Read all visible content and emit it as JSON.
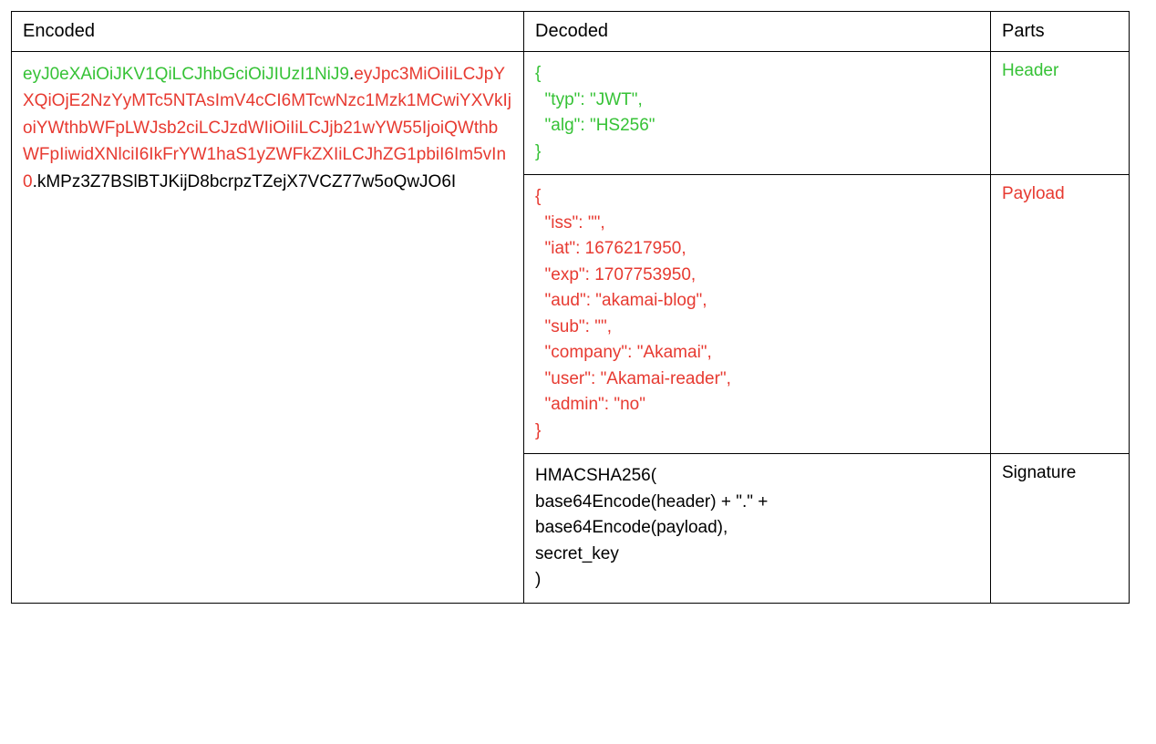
{
  "headers": {
    "encoded": "Encoded",
    "decoded": "Decoded",
    "parts": "Parts"
  },
  "encoded": {
    "header_part": "eyJ0eXAiOiJKV1QiLCJhbGciOiJIUzI1NiJ9",
    "dot1": ".",
    "payload_part": "eyJpc3MiOiIiLCJpYXQiOjE2NzYyMTc5NTAsImV4cCI6MTcwNzc1Mzk1MCwiYXVkIjoiYWthbWFpLWJsb2ciLCJzdWIiOiIiLCJjb21wYW55IjoiQWthbWFpIiwidXNlciI6IkFrYW1haS1yZWFkZXIiLCJhZG1pbiI6Im5vIn0",
    "dot2": ".",
    "sig_part": "kMPz3Z7BSlBTJKijD8bcrpzTZejX7VCZ77w5oQwJO6I"
  },
  "decoded": {
    "header_json": "{\n  \"typ\": \"JWT\",\n  \"alg\": \"HS256\"\n}",
    "payload_json": "{\n  \"iss\": \"\",\n  \"iat\": 1676217950,\n  \"exp\": 1707753950,\n  \"aud\": \"akamai-blog\",\n  \"sub\": \"\",\n  \"company\": \"Akamai\",\n  \"user\": \"Akamai-reader\",\n  \"admin\": \"no\"\n}",
    "signature_text": "HMACSHA256(\nbase64Encode(header) + \".\" +\nbase64Encode(payload),\nsecret_key\n)"
  },
  "parts": {
    "header": "Header",
    "payload": "Payload",
    "signature": "Signature"
  }
}
